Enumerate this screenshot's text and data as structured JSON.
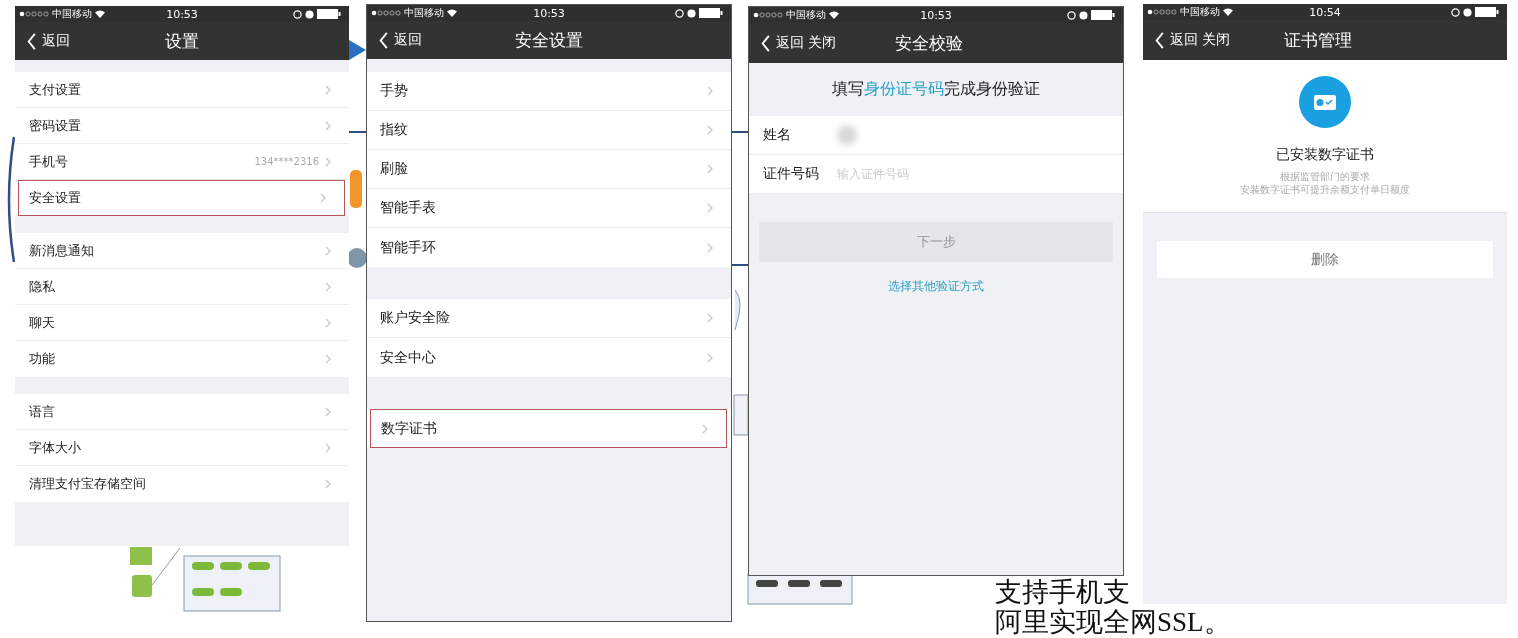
{
  "screens": [
    {
      "kind": "list",
      "status_bar": {
        "carrier": "中国移动",
        "time": "10:53"
      },
      "nav": {
        "back": "返回",
        "title": "设置"
      },
      "groups": [
        {
          "items": [
            {
              "label": "支付设置",
              "highlighted": false
            },
            {
              "label": "密码设置",
              "highlighted": false
            },
            {
              "label": "手机号",
              "value": "134****2316",
              "highlighted": false
            },
            {
              "label": "安全设置",
              "highlighted": true
            }
          ]
        },
        {
          "items": [
            {
              "label": "新消息通知",
              "highlighted": false
            },
            {
              "label": "隐私",
              "highlighted": false
            },
            {
              "label": "聊天",
              "highlighted": false
            },
            {
              "label": "功能",
              "highlighted": false
            }
          ]
        },
        {
          "items": [
            {
              "label": "语言",
              "highlighted": false
            },
            {
              "label": "字体大小",
              "highlighted": false
            },
            {
              "label": "清理支付宝存储空间",
              "highlighted": false
            }
          ]
        }
      ]
    },
    {
      "kind": "list",
      "status_bar": {
        "carrier": "中国移动",
        "time": "10:53"
      },
      "nav": {
        "back": "返回",
        "title": "安全设置"
      },
      "groups": [
        {
          "items": [
            {
              "label": "手势",
              "highlighted": false
            },
            {
              "label": "指纹",
              "highlighted": false
            },
            {
              "label": "刷脸",
              "highlighted": false
            },
            {
              "label": "智能手表",
              "highlighted": false
            },
            {
              "label": "智能手环",
              "highlighted": false
            }
          ]
        },
        {
          "items": [
            {
              "label": "账户安全险",
              "highlighted": false
            },
            {
              "label": "安全中心",
              "highlighted": false
            }
          ]
        },
        {
          "items": [
            {
              "label": "数字证书",
              "highlighted": true
            }
          ]
        }
      ]
    },
    {
      "kind": "form",
      "status_bar": {
        "carrier": "中国移动",
        "time": "10:53"
      },
      "nav": {
        "back": "返回",
        "close": "关闭",
        "title": "安全校验"
      },
      "prompt": {
        "before": "填写",
        "highlight": "身份证号码",
        "after": "完成身份验证"
      },
      "fields": [
        {
          "kind": "masked",
          "label": "姓名"
        },
        {
          "kind": "input",
          "label": "证件号码",
          "placeholder": "输入证件号码"
        }
      ],
      "submit": {
        "label": "下一步",
        "disabled": true
      },
      "link": "选择其他验证方式"
    },
    {
      "kind": "certificate",
      "status_bar": {
        "carrier": "中国移动",
        "time": "10:54"
      },
      "nav": {
        "back": "返回",
        "close": "关闭",
        "title": "证书管理"
      },
      "title": "已安装数字证书",
      "notes": [
        "根据监管部门的要求",
        "安装数字证书可提升余额支付单日额度"
      ],
      "action": "删除"
    }
  ],
  "slide_text": [
    "支持手机支",
    "阿里实现全网SSL。"
  ]
}
